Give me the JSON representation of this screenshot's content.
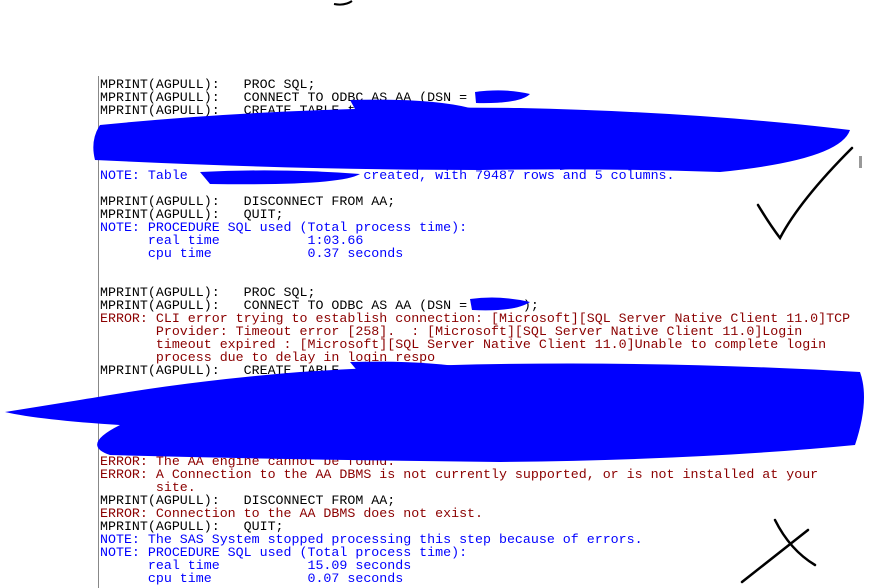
{
  "colors": {
    "note": "#0000ff",
    "error": "#8b0000",
    "mprint": "#000000",
    "redaction": "#0000ff"
  },
  "log_lines": [
    {
      "type": "mprint",
      "text": "MPRINT(AGPULL):   PROC SQL;"
    },
    {
      "type": "mprint",
      "text": "MPRINT(AGPULL):   CONNECT TO ODBC AS AA (DSN = "
    },
    {
      "type": "mprint",
      "text": "MPRINT(AGPULL):   CREATE TABLE t"
    },
    {
      "type": "redacted",
      "text": ""
    },
    {
      "type": "redacted",
      "text": ""
    },
    {
      "type": "redacted",
      "text": ""
    },
    {
      "type": "redacted",
      "text": ""
    },
    {
      "type": "note",
      "text": "NOTE: Table                      created, with 79487 rows and 5 columns."
    },
    {
      "type": "blank",
      "text": ""
    },
    {
      "type": "mprint",
      "text": "MPRINT(AGPULL):   DISCONNECT FROM AA;"
    },
    {
      "type": "mprint",
      "text": "MPRINT(AGPULL):   QUIT;"
    },
    {
      "type": "note",
      "text": "NOTE: PROCEDURE SQL used (Total process time):"
    },
    {
      "type": "note",
      "text": "      real time           1:03.66"
    },
    {
      "type": "note",
      "text": "      cpu time            0.37 seconds"
    },
    {
      "type": "blank",
      "text": ""
    },
    {
      "type": "blank",
      "text": ""
    },
    {
      "type": "mprint",
      "text": "MPRINT(AGPULL):   PROC SQL;"
    },
    {
      "type": "mprint",
      "text": "MPRINT(AGPULL):   CONNECT TO ODBC AS AA (DSN =       );"
    },
    {
      "type": "error",
      "text": "ERROR: CLI error trying to establish connection: [Microsoft][SQL Server Native Client 11.0]TCP"
    },
    {
      "type": "error",
      "text": "       Provider: Timeout error [258].  : [Microsoft][SQL Server Native Client 11.0]Login"
    },
    {
      "type": "error",
      "text": "       timeout expired : [Microsoft][SQL Server Native Client 11.0]Unable to complete login"
    },
    {
      "type": "error",
      "text": "       process due to delay in login respo"
    },
    {
      "type": "mprint",
      "text": "MPRINT(AGPULL):   CREATE TABLE"
    },
    {
      "type": "redacted",
      "text": ""
    },
    {
      "type": "redacted",
      "text": ""
    },
    {
      "type": "redacted",
      "text": ""
    },
    {
      "type": "redacted",
      "text": ""
    },
    {
      "type": "redacted",
      "text": ""
    },
    {
      "type": "redacted",
      "text": ""
    },
    {
      "type": "error",
      "text": "ERROR: The AA engine cannot be found."
    },
    {
      "type": "error",
      "text": "ERROR: A Connection to the AA DBMS is not currently supported, or is not installed at your"
    },
    {
      "type": "error",
      "text": "       site."
    },
    {
      "type": "mprint",
      "text": "MPRINT(AGPULL):   DISCONNECT FROM AA;"
    },
    {
      "type": "error",
      "text": "ERROR: Connection to the AA DBMS does not exist."
    },
    {
      "type": "mprint",
      "text": "MPRINT(AGPULL):   QUIT;"
    },
    {
      "type": "note",
      "text": "NOTE: The SAS System stopped processing this step because of errors."
    },
    {
      "type": "note",
      "text": "NOTE: PROCEDURE SQL used (Total process time):"
    },
    {
      "type": "note",
      "text": "      real time           15.09 seconds"
    },
    {
      "type": "note",
      "text": "      cpu time            0.07 seconds"
    }
  ]
}
